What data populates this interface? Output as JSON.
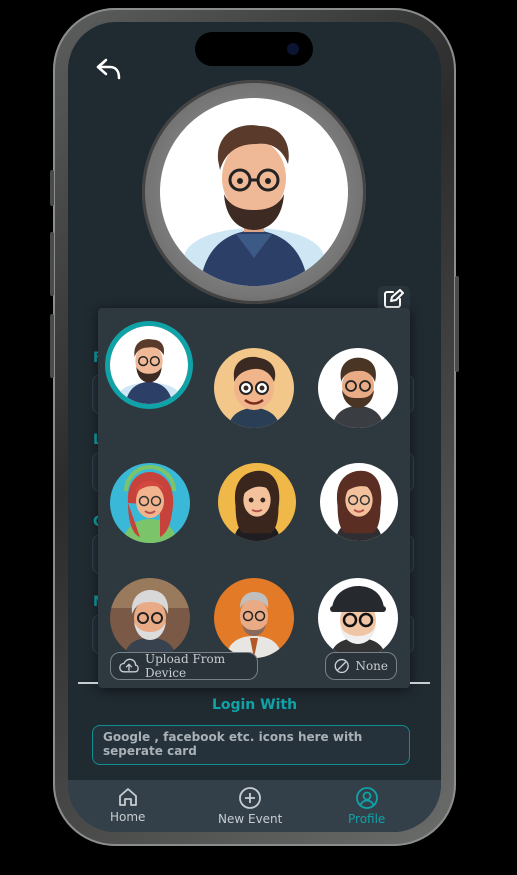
{
  "header": {
    "back_icon": "reply-arrow-icon"
  },
  "profile": {
    "edit_icon": "edit-square-pen-icon"
  },
  "form": {
    "labels": [
      "F",
      "L",
      "C",
      "M"
    ]
  },
  "avatar_picker": {
    "avatars": [
      {
        "name": "avatar-bearded-man-glasses",
        "selected": true
      },
      {
        "name": "avatar-cartoon-man-glasses",
        "selected": false
      },
      {
        "name": "avatar-bearded-man-hoodie",
        "selected": false
      },
      {
        "name": "avatar-woman-headphones",
        "selected": false
      },
      {
        "name": "avatar-woman-brown-hair",
        "selected": false
      },
      {
        "name": "avatar-woman-glasses",
        "selected": false
      },
      {
        "name": "avatar-older-man-glasses",
        "selected": false
      },
      {
        "name": "avatar-older-man-suit",
        "selected": false
      },
      {
        "name": "avatar-elderly-man-hat",
        "selected": false
      }
    ],
    "upload_label": "Upload From Device",
    "none_label": "None"
  },
  "login": {
    "title": "Login With",
    "placeholder_text": "Google , facebook etc. icons here with seperate card"
  },
  "nav": {
    "items": [
      {
        "label": "Home",
        "icon": "home-icon",
        "active": false
      },
      {
        "label": "New Event",
        "icon": "plus-circle-icon",
        "active": false
      },
      {
        "label": "Profile",
        "icon": "profile-icon",
        "active": true
      }
    ]
  },
  "colors": {
    "accent": "#0fa3a7",
    "background": "#202a31",
    "nav": "#33404a"
  }
}
